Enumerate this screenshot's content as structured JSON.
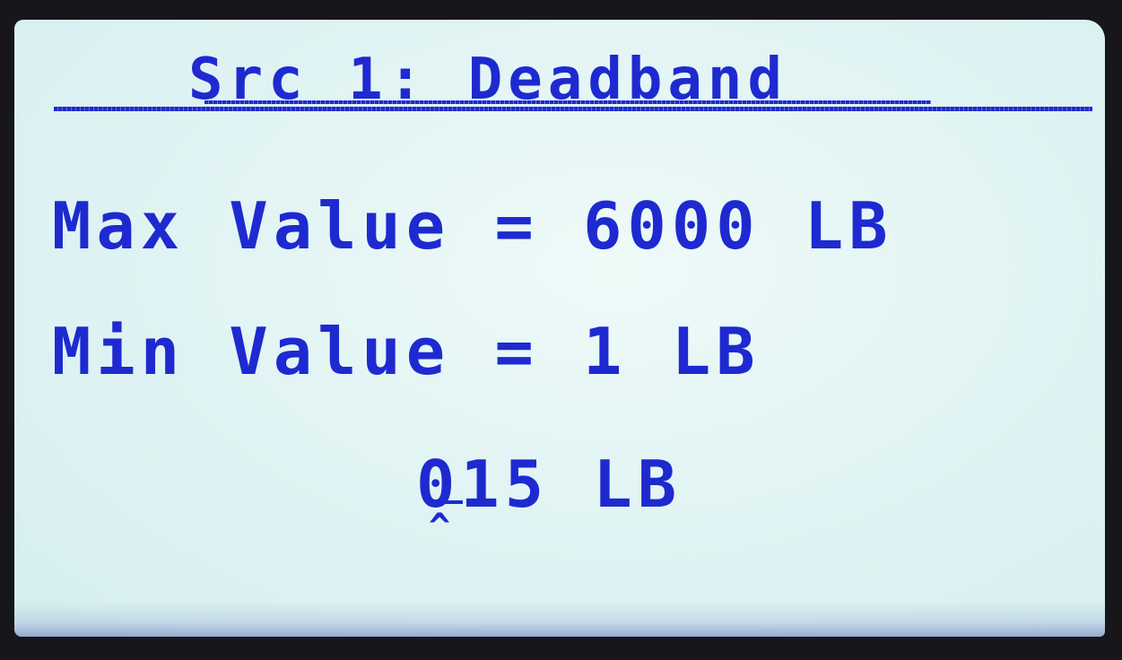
{
  "display": {
    "title": "Src 1: Deadband",
    "max_row": "Max Value = 6000 LB",
    "min_row": "Min Value = 1 LB",
    "edit_value": "015 LB",
    "cursor_glyph": "^"
  },
  "colors": {
    "lcd_text": "#1e2ad0",
    "lcd_background": "#e2f4f4",
    "bezel": "#17171b"
  }
}
